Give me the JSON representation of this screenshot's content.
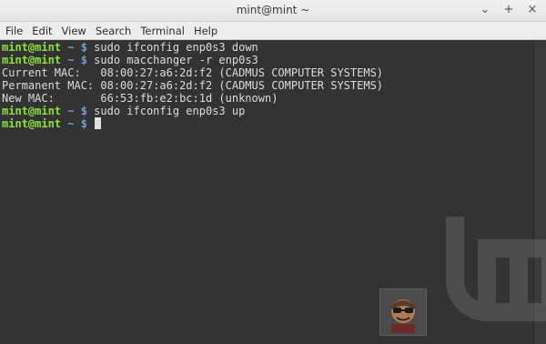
{
  "window": {
    "title": "mint@mint ~",
    "controls": [
      {
        "label": "⌄",
        "name": "minimize-button"
      },
      {
        "label": "+",
        "name": "maximize-button"
      },
      {
        "label": "×",
        "name": "close-button"
      }
    ]
  },
  "menu": {
    "items": [
      "File",
      "Edit",
      "View",
      "Search",
      "Terminal",
      "Help"
    ]
  },
  "terminal": {
    "prompt_user": "mint@mint",
    "prompt_path": " ~ $ ",
    "lines": [
      {
        "type": "command",
        "text": "sudo ifconfig enp0s3 down"
      },
      {
        "type": "command",
        "text": "sudo macchanger -r enp0s3"
      },
      {
        "type": "output",
        "text": "Current MAC:   08:00:27:a6:2d:f2 (CADMUS COMPUTER SYSTEMS)"
      },
      {
        "type": "output",
        "text": "Permanent MAC: 08:00:27:a6:2d:f2 (CADMUS COMPUTER SYSTEMS)"
      },
      {
        "type": "output",
        "text": "New MAC:       66:53:fb:e2:bc:1d (unknown)"
      },
      {
        "type": "command",
        "text": "sudo ifconfig enp0s3 up"
      },
      {
        "type": "command",
        "text": "",
        "cursor": true
      }
    ]
  },
  "colors": {
    "background": "#333333",
    "prompt_user": "#8ae234",
    "prompt_path": "#729fcf",
    "text": "#dcdcdc"
  },
  "icons": [
    "mint-logo-watermark",
    "avatar-icon"
  ]
}
